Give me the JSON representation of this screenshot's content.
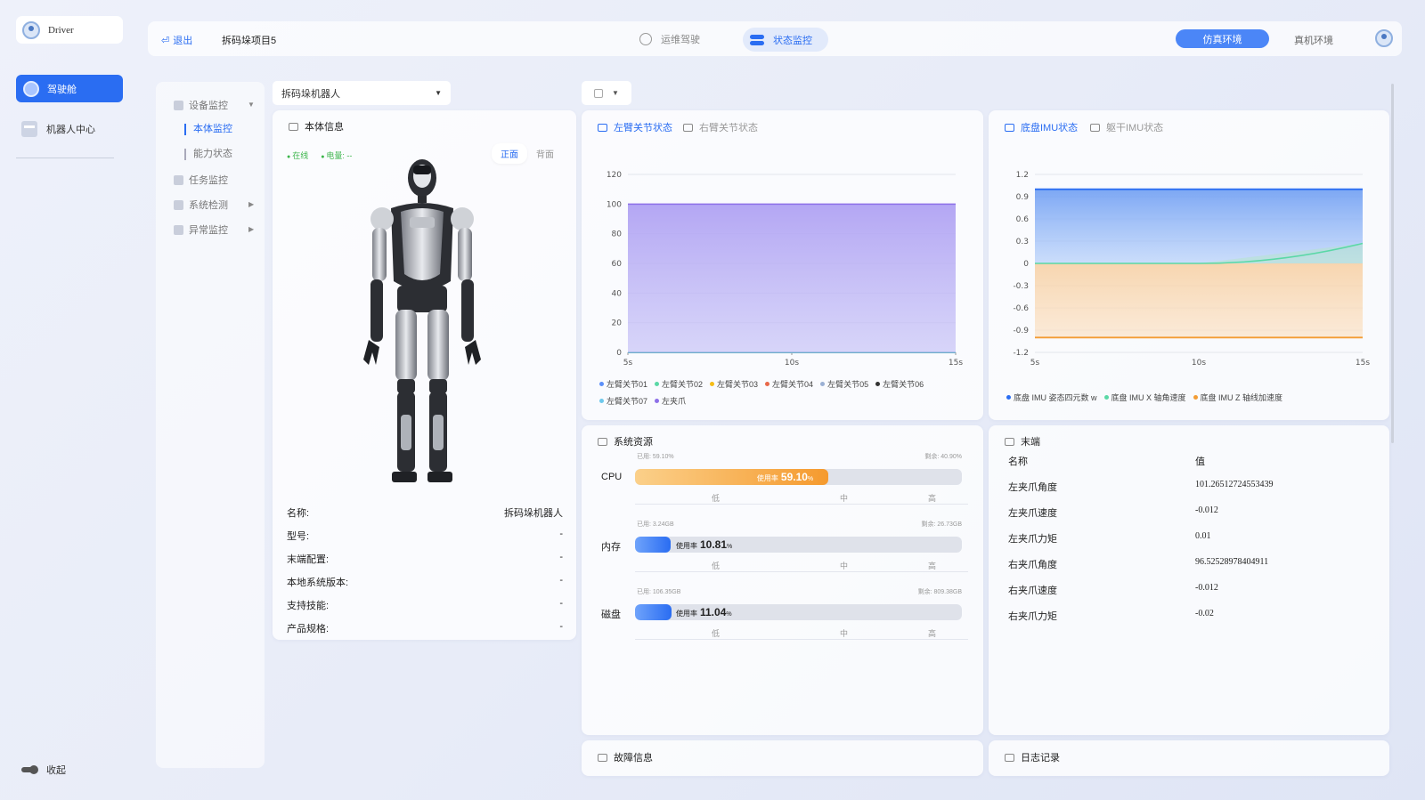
{
  "user": {
    "name": "Driver"
  },
  "nav": {
    "cockpit": "驾驶舱",
    "robot_center": "机器人中心",
    "collapse": "收起"
  },
  "topbar": {
    "exit": "退出",
    "project": "拆码垛项目5",
    "tab_ops": "运维驾驶",
    "tab_status": "状态监控",
    "env_sim": "仿真环境",
    "env_real": "真机环境"
  },
  "submenu": {
    "device": "设备监控",
    "body": "本体监控",
    "capability": "能力状态",
    "task": "任务监控",
    "system": "系统检测",
    "abnormal": "异常监控"
  },
  "robot_select": {
    "value": "拆码垛机器人"
  },
  "body_card": {
    "title": "本体信息",
    "online": "在线",
    "battery": "电量: --",
    "front": "正面",
    "back": "背面",
    "rows": [
      {
        "label": "名称:",
        "value": "拆码垛机器人"
      },
      {
        "label": "型号:",
        "value": "-"
      },
      {
        "label": "末端配置:",
        "value": "-"
      },
      {
        "label": "本地系统版本:",
        "value": "-"
      },
      {
        "label": "支持技能:",
        "value": "-"
      },
      {
        "label": "产品规格:",
        "value": "-"
      }
    ]
  },
  "arm_chart": {
    "tab_left": "左臂关节状态",
    "tab_right": "右臂关节状态",
    "chart_data": {
      "type": "area",
      "x": [
        "5s",
        "10s",
        "15s"
      ],
      "ylim": [
        0,
        120
      ],
      "yticks": [
        120,
        100,
        80,
        60,
        40,
        20,
        0
      ],
      "series": [
        {
          "name": "左臂关节01",
          "values": [
            0,
            0,
            0
          ],
          "color": "#5b8ff9"
        },
        {
          "name": "左臂关节02",
          "values": [
            0,
            0,
            0
          ],
          "color": "#5ad8a6"
        },
        {
          "name": "左臂关节03",
          "values": [
            0,
            0,
            0
          ],
          "color": "#f6bd16"
        },
        {
          "name": "左臂关节04",
          "values": [
            0,
            0,
            0
          ],
          "color": "#e8684a"
        },
        {
          "name": "左臂关节05",
          "values": [
            0,
            0,
            0
          ],
          "color": "#9ab0d4"
        },
        {
          "name": "左臂关节06",
          "values": [
            0,
            0,
            0
          ],
          "color": "#333333"
        },
        {
          "name": "左臂关节07",
          "values": [
            0,
            0,
            0
          ],
          "color": "#6dc8ec"
        },
        {
          "name": "左夹爪",
          "values": [
            100,
            100,
            100
          ],
          "color": "#8d70e8"
        }
      ]
    }
  },
  "imu_chart": {
    "tab_left": "底盘IMU状态",
    "tab_right": "躯干IMU状态",
    "chart_data": {
      "type": "area",
      "x": [
        "5s",
        "10s",
        "15s"
      ],
      "ylim": [
        -1.2,
        1.2
      ],
      "yticks": [
        "1.2",
        "0.9",
        "0.6",
        "0.3",
        "0",
        "-0.3",
        "-0.6",
        "-0.9",
        "-1.2"
      ],
      "series": [
        {
          "name": "底盘 IMU 姿态四元数 w",
          "values": [
            1,
            1,
            1
          ],
          "color": "#2a6df2"
        },
        {
          "name": "底盘 IMU X 轴角速度",
          "values": [
            0,
            0,
            0.27
          ],
          "color": "#5ad8a6"
        },
        {
          "name": "底盘 IMU Z 轴线加速度",
          "values": [
            -1,
            -1,
            -1
          ],
          "color": "#f39c34"
        }
      ]
    }
  },
  "resources": {
    "title": "系统资源",
    "scale_low": "低",
    "scale_mid": "中",
    "scale_high": "高",
    "usage_label": "使用率",
    "items": [
      {
        "label": "CPU",
        "used": "已用: 59.10%",
        "left": "剩余: 40.90%",
        "value": "59.10",
        "unit": "%",
        "pct": 59.1,
        "color": "#f7a840"
      },
      {
        "label": "内存",
        "used": "已用: 3.24GB",
        "left": "剩余: 26.73GB",
        "value": "10.81",
        "unit": "%",
        "pct": 10.81,
        "color": "#3b7cf5"
      },
      {
        "label": "磁盘",
        "used": "已用: 106.35GB",
        "left": "剩余: 809.38GB",
        "value": "11.04",
        "unit": "%",
        "pct": 11.04,
        "color": "#3b7cf5"
      }
    ]
  },
  "end_effector": {
    "title": "末端",
    "col_name": "名称",
    "col_value": "值",
    "rows": [
      {
        "name": "左夹爪角度",
        "value": "101.26512724553439"
      },
      {
        "name": "左夹爪速度",
        "value": "-0.012"
      },
      {
        "name": "左夹爪力矩",
        "value": "0.01"
      },
      {
        "name": "右夹爪角度",
        "value": "96.52528978404911"
      },
      {
        "name": "右夹爪速度",
        "value": "-0.012"
      },
      {
        "name": "右夹爪力矩",
        "value": "-0.02"
      }
    ]
  },
  "fault": {
    "title": "故障信息"
  },
  "log": {
    "title": "日志记录"
  }
}
